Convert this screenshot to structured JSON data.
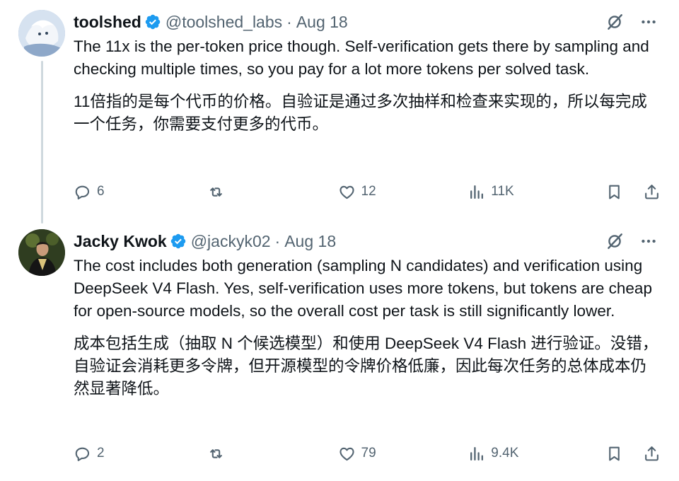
{
  "tweets": [
    {
      "display_name": "toolshed",
      "handle": "@toolshed_labs",
      "separator": "·",
      "date": "Aug 18",
      "text_en": "The 11x is the per-token price though. Self-verification gets there by sampling and checking multiple times, so you pay for a lot more tokens per solved task.",
      "text_zh": "11倍指的是每个代币的价格。自验证是通过多次抽样和检查来实现的，所以每完成一个任务，你需要支付更多的代币。",
      "replies": "6",
      "retweets": "",
      "likes": "12",
      "views": "11K"
    },
    {
      "display_name": "Jacky Kwok",
      "handle": "@jackyk02",
      "separator": "·",
      "date": "Aug 18",
      "text_en": "The cost includes both generation (sampling N candidates) and verification using DeepSeek V4 Flash. Yes, self-verification uses more tokens, but tokens are cheap for open-source models, so the overall cost per task is still significantly lower.",
      "text_zh": "成本包括生成（抽取 N 个候选模型）和使用 DeepSeek V4 Flash 进行验证。没错，自验证会消耗更多令牌，但开源模型的令牌价格低廉，因此每次任务的总体成本仍然显著降低。",
      "replies": "2",
      "retweets": "",
      "likes": "79",
      "views": "9.4K"
    }
  ],
  "colors": {
    "text": "#0f1419",
    "secondary": "#536471",
    "verified": "#1d9bf0",
    "thread_line": "#cfd9de"
  },
  "icons": [
    "verified-badge-icon",
    "grok-icon",
    "more-icon",
    "reply-icon",
    "retweet-icon",
    "like-icon",
    "views-icon",
    "bookmark-icon",
    "share-icon"
  ]
}
